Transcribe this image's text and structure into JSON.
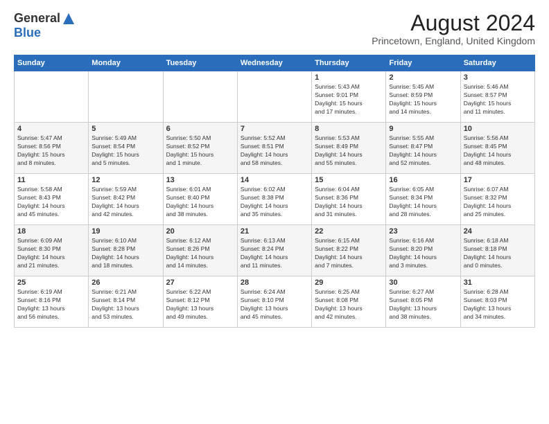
{
  "header": {
    "logo_general": "General",
    "logo_blue": "Blue",
    "month_title": "August 2024",
    "location": "Princetown, England, United Kingdom"
  },
  "weekdays": [
    "Sunday",
    "Monday",
    "Tuesday",
    "Wednesday",
    "Thursday",
    "Friday",
    "Saturday"
  ],
  "weeks": [
    [
      {
        "day": "",
        "info": ""
      },
      {
        "day": "",
        "info": ""
      },
      {
        "day": "",
        "info": ""
      },
      {
        "day": "",
        "info": ""
      },
      {
        "day": "1",
        "info": "Sunrise: 5:43 AM\nSunset: 9:01 PM\nDaylight: 15 hours\nand 17 minutes."
      },
      {
        "day": "2",
        "info": "Sunrise: 5:45 AM\nSunset: 8:59 PM\nDaylight: 15 hours\nand 14 minutes."
      },
      {
        "day": "3",
        "info": "Sunrise: 5:46 AM\nSunset: 8:57 PM\nDaylight: 15 hours\nand 11 minutes."
      }
    ],
    [
      {
        "day": "4",
        "info": "Sunrise: 5:47 AM\nSunset: 8:56 PM\nDaylight: 15 hours\nand 8 minutes."
      },
      {
        "day": "5",
        "info": "Sunrise: 5:49 AM\nSunset: 8:54 PM\nDaylight: 15 hours\nand 5 minutes."
      },
      {
        "day": "6",
        "info": "Sunrise: 5:50 AM\nSunset: 8:52 PM\nDaylight: 15 hours\nand 1 minute."
      },
      {
        "day": "7",
        "info": "Sunrise: 5:52 AM\nSunset: 8:51 PM\nDaylight: 14 hours\nand 58 minutes."
      },
      {
        "day": "8",
        "info": "Sunrise: 5:53 AM\nSunset: 8:49 PM\nDaylight: 14 hours\nand 55 minutes."
      },
      {
        "day": "9",
        "info": "Sunrise: 5:55 AM\nSunset: 8:47 PM\nDaylight: 14 hours\nand 52 minutes."
      },
      {
        "day": "10",
        "info": "Sunrise: 5:56 AM\nSunset: 8:45 PM\nDaylight: 14 hours\nand 48 minutes."
      }
    ],
    [
      {
        "day": "11",
        "info": "Sunrise: 5:58 AM\nSunset: 8:43 PM\nDaylight: 14 hours\nand 45 minutes."
      },
      {
        "day": "12",
        "info": "Sunrise: 5:59 AM\nSunset: 8:42 PM\nDaylight: 14 hours\nand 42 minutes."
      },
      {
        "day": "13",
        "info": "Sunrise: 6:01 AM\nSunset: 8:40 PM\nDaylight: 14 hours\nand 38 minutes."
      },
      {
        "day": "14",
        "info": "Sunrise: 6:02 AM\nSunset: 8:38 PM\nDaylight: 14 hours\nand 35 minutes."
      },
      {
        "day": "15",
        "info": "Sunrise: 6:04 AM\nSunset: 8:36 PM\nDaylight: 14 hours\nand 31 minutes."
      },
      {
        "day": "16",
        "info": "Sunrise: 6:05 AM\nSunset: 8:34 PM\nDaylight: 14 hours\nand 28 minutes."
      },
      {
        "day": "17",
        "info": "Sunrise: 6:07 AM\nSunset: 8:32 PM\nDaylight: 14 hours\nand 25 minutes."
      }
    ],
    [
      {
        "day": "18",
        "info": "Sunrise: 6:09 AM\nSunset: 8:30 PM\nDaylight: 14 hours\nand 21 minutes."
      },
      {
        "day": "19",
        "info": "Sunrise: 6:10 AM\nSunset: 8:28 PM\nDaylight: 14 hours\nand 18 minutes."
      },
      {
        "day": "20",
        "info": "Sunrise: 6:12 AM\nSunset: 8:26 PM\nDaylight: 14 hours\nand 14 minutes."
      },
      {
        "day": "21",
        "info": "Sunrise: 6:13 AM\nSunset: 8:24 PM\nDaylight: 14 hours\nand 11 minutes."
      },
      {
        "day": "22",
        "info": "Sunrise: 6:15 AM\nSunset: 8:22 PM\nDaylight: 14 hours\nand 7 minutes."
      },
      {
        "day": "23",
        "info": "Sunrise: 6:16 AM\nSunset: 8:20 PM\nDaylight: 14 hours\nand 3 minutes."
      },
      {
        "day": "24",
        "info": "Sunrise: 6:18 AM\nSunset: 8:18 PM\nDaylight: 14 hours\nand 0 minutes."
      }
    ],
    [
      {
        "day": "25",
        "info": "Sunrise: 6:19 AM\nSunset: 8:16 PM\nDaylight: 13 hours\nand 56 minutes."
      },
      {
        "day": "26",
        "info": "Sunrise: 6:21 AM\nSunset: 8:14 PM\nDaylight: 13 hours\nand 53 minutes."
      },
      {
        "day": "27",
        "info": "Sunrise: 6:22 AM\nSunset: 8:12 PM\nDaylight: 13 hours\nand 49 minutes."
      },
      {
        "day": "28",
        "info": "Sunrise: 6:24 AM\nSunset: 8:10 PM\nDaylight: 13 hours\nand 45 minutes."
      },
      {
        "day": "29",
        "info": "Sunrise: 6:25 AM\nSunset: 8:08 PM\nDaylight: 13 hours\nand 42 minutes."
      },
      {
        "day": "30",
        "info": "Sunrise: 6:27 AM\nSunset: 8:05 PM\nDaylight: 13 hours\nand 38 minutes."
      },
      {
        "day": "31",
        "info": "Sunrise: 6:28 AM\nSunset: 8:03 PM\nDaylight: 13 hours\nand 34 minutes."
      }
    ]
  ]
}
